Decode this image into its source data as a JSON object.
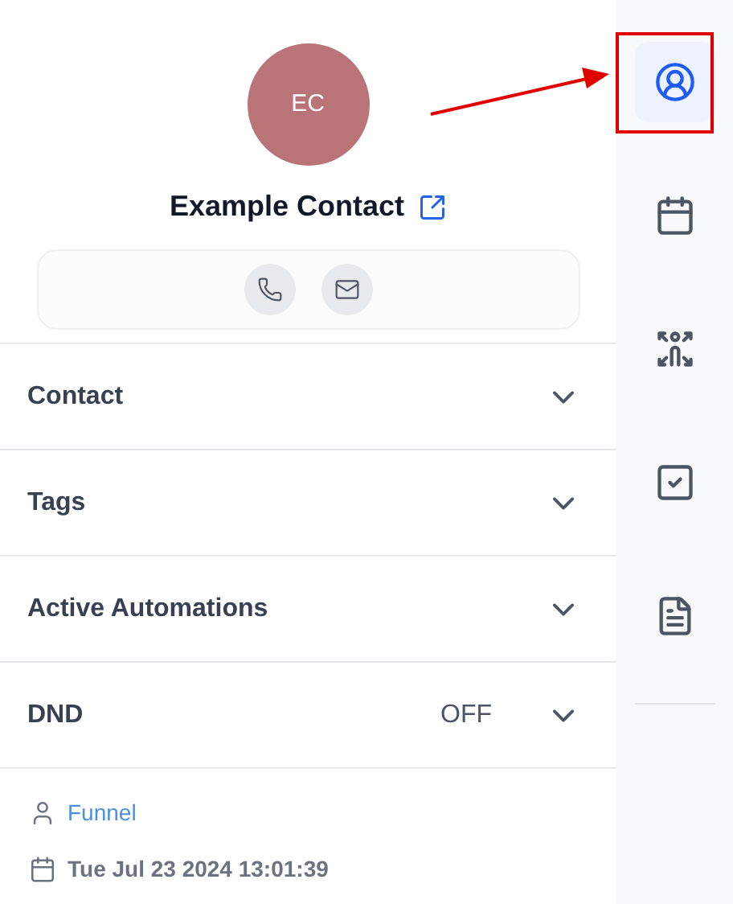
{
  "contact": {
    "initials": "EC",
    "name": "Example Contact"
  },
  "sections": [
    {
      "title": "Contact",
      "expanded": false
    },
    {
      "title": "Tags",
      "expanded": false
    },
    {
      "title": "Active Automations",
      "expanded": false
    },
    {
      "title": "DND",
      "value": "OFF",
      "expanded": false
    }
  ],
  "source": "Funnel",
  "created": "Tue Jul 23 2024 13:01:39",
  "rail": [
    {
      "kind": "profile",
      "selected": true
    },
    {
      "kind": "calendar",
      "selected": false
    },
    {
      "kind": "automation",
      "selected": false
    },
    {
      "kind": "task",
      "selected": false
    },
    {
      "kind": "note",
      "selected": false
    }
  ]
}
